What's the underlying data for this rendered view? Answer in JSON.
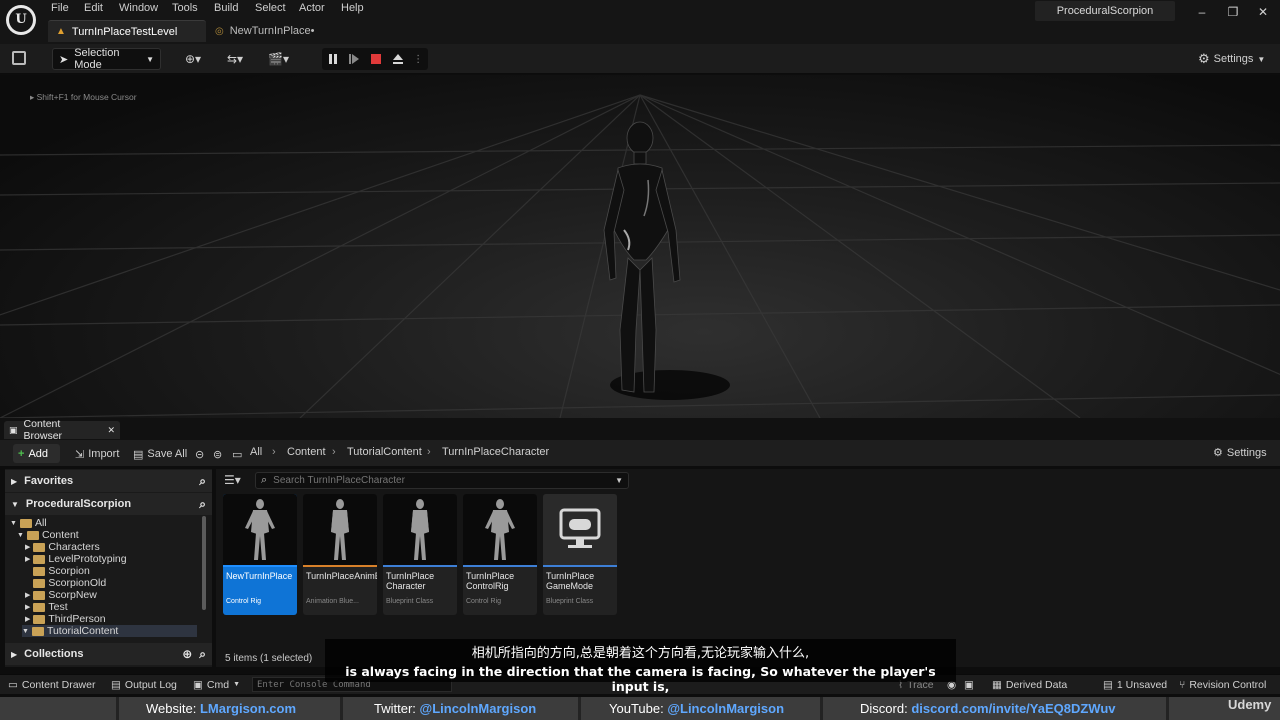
{
  "menu": [
    "File",
    "Edit",
    "Window",
    "Tools",
    "Build",
    "Select",
    "Actor",
    "Help"
  ],
  "tabs": [
    "TurnInPlaceTestLevel",
    "NewTurnInPlace•"
  ],
  "project_name": "ProceduralScorpion",
  "toolbar": {
    "mode_label": "Selection Mode",
    "settings_label": "Settings"
  },
  "viewport": {
    "hint": "Shift+F1 for Mouse Cursor"
  },
  "content_browser": {
    "tab_label": "Content Browser",
    "add_label": "Add",
    "import_label": "Import",
    "save_all_label": "Save All",
    "breadcrumb": [
      "All",
      "Content",
      "TutorialContent",
      "TurnInPlaceCharacter"
    ],
    "settings_label": "Settings",
    "favorites_label": "Favorites",
    "project_label": "ProceduralScorpion",
    "collections_label": "Collections",
    "search_placeholder": "Search TurnInPlaceCharacter",
    "tree": [
      "All",
      "Content",
      "Characters",
      "LevelPrototyping",
      "Scorpion",
      "ScorpionOld",
      "ScorpNew",
      "Test",
      "ThirdPerson",
      "TutorialContent"
    ],
    "assets": [
      {
        "name": "NewTurnInPlace",
        "type": "Control Rig",
        "stripe": "#1f8fff"
      },
      {
        "name": "TurnInPlaceAnimBP",
        "type": "Animation Blue...",
        "stripe": "#d8812a"
      },
      {
        "name": "TurnInPlace Character",
        "type": "Blueprint Class",
        "stripe": "#3d7fd6"
      },
      {
        "name": "TurnInPlace ControlRig",
        "type": "Control Rig",
        "stripe": "#3d7fd6"
      },
      {
        "name": "TurnInPlace GameMode",
        "type": "Blueprint Class",
        "stripe": "#3d7fd6"
      }
    ],
    "item_count": "5 items (1 selected)"
  },
  "subtitles": {
    "cn": "相机所指向的方向,总是朝着这个方向看,无论玩家输入什么,",
    "en": "is always facing in the direction that the camera is facing, So whatever the player's input is,"
  },
  "statusbar": {
    "content_drawer": "Content Drawer",
    "output_log": "Output Log",
    "cmd": "Cmd",
    "console_placeholder": "Enter Console Command",
    "trace": "Trace",
    "derived_data": "Derived Data",
    "unsaved": "1 Unsaved",
    "revision_control": "Revision Control"
  },
  "promo": {
    "website_label": "Website:",
    "website": "LMargison.com",
    "twitter_label": "Twitter:",
    "twitter": "@LincolnMargison",
    "youtube_label": "YouTube:",
    "youtube": "@LincolnMargison",
    "discord_label": "Discord:",
    "discord": "discord.com/invite/YaEQ8DZWuv",
    "watermark": "Udemy"
  }
}
